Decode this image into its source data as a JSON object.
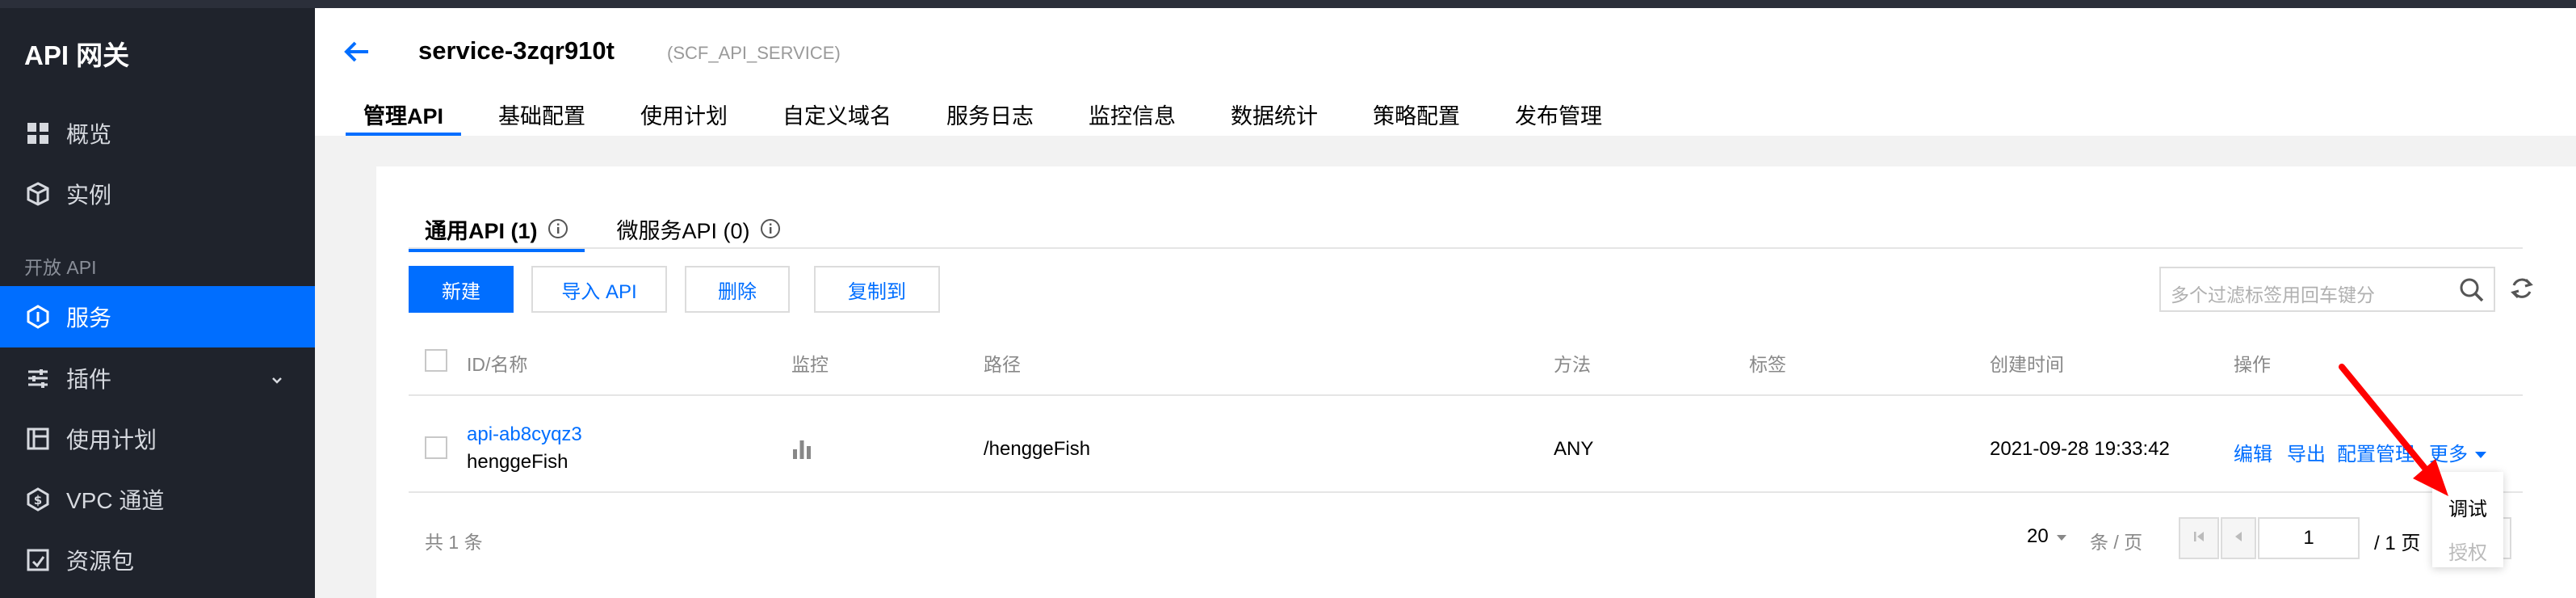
{
  "sidebar": {
    "brand": "API 网关",
    "items": [
      {
        "label": "概览",
        "icon": "grid-icon"
      },
      {
        "label": "实例",
        "icon": "cube-icon"
      },
      {
        "label": "服务",
        "icon": "service-icon"
      },
      {
        "label": "插件",
        "icon": "sliders-icon"
      },
      {
        "label": "使用计划",
        "icon": "plan-icon"
      },
      {
        "label": "VPC 通道",
        "icon": "vpc-icon"
      },
      {
        "label": "资源包",
        "icon": "package-icon"
      }
    ],
    "section_label": "开放 API"
  },
  "header": {
    "title": "service-3zqr910t",
    "subtitle": "(SCF_API_SERVICE)",
    "tabs": [
      "管理API",
      "基础配置",
      "使用计划",
      "自定义域名",
      "服务日志",
      "监控信息",
      "数据统计",
      "策略配置",
      "发布管理"
    ]
  },
  "subtabs": {
    "general": "通用API (1)",
    "micro": "微服务API (0)"
  },
  "toolbar": {
    "new": "新建",
    "import": "导入 API",
    "delete": "删除",
    "copy": "复制到",
    "search_placeholder": "多个过滤标签用回车键分"
  },
  "table": {
    "headers": [
      "ID/名称",
      "监控",
      "路径",
      "方法",
      "标签",
      "创建时间",
      "操作"
    ],
    "rows": [
      {
        "id": "api-ab8cyqz3",
        "name": "henggeFish",
        "path": "/henggeFish",
        "method": "ANY",
        "created": "2021-09-28 19:33:42",
        "actions": [
          "编辑",
          "导出",
          "配置管理",
          "更多"
        ]
      }
    ]
  },
  "dropdown": {
    "items": [
      {
        "label": "调试",
        "enabled": true
      },
      {
        "label": "授权",
        "enabled": false
      }
    ]
  },
  "footer": {
    "total": "共 1 条",
    "page_size": "20",
    "page_size_unit": "条 / 页",
    "page": "1",
    "page_total": "/ 1 页"
  },
  "colors": {
    "accent": "#006eff",
    "sidebar_bg": "#1f232c",
    "arrow": "#ff0000"
  }
}
